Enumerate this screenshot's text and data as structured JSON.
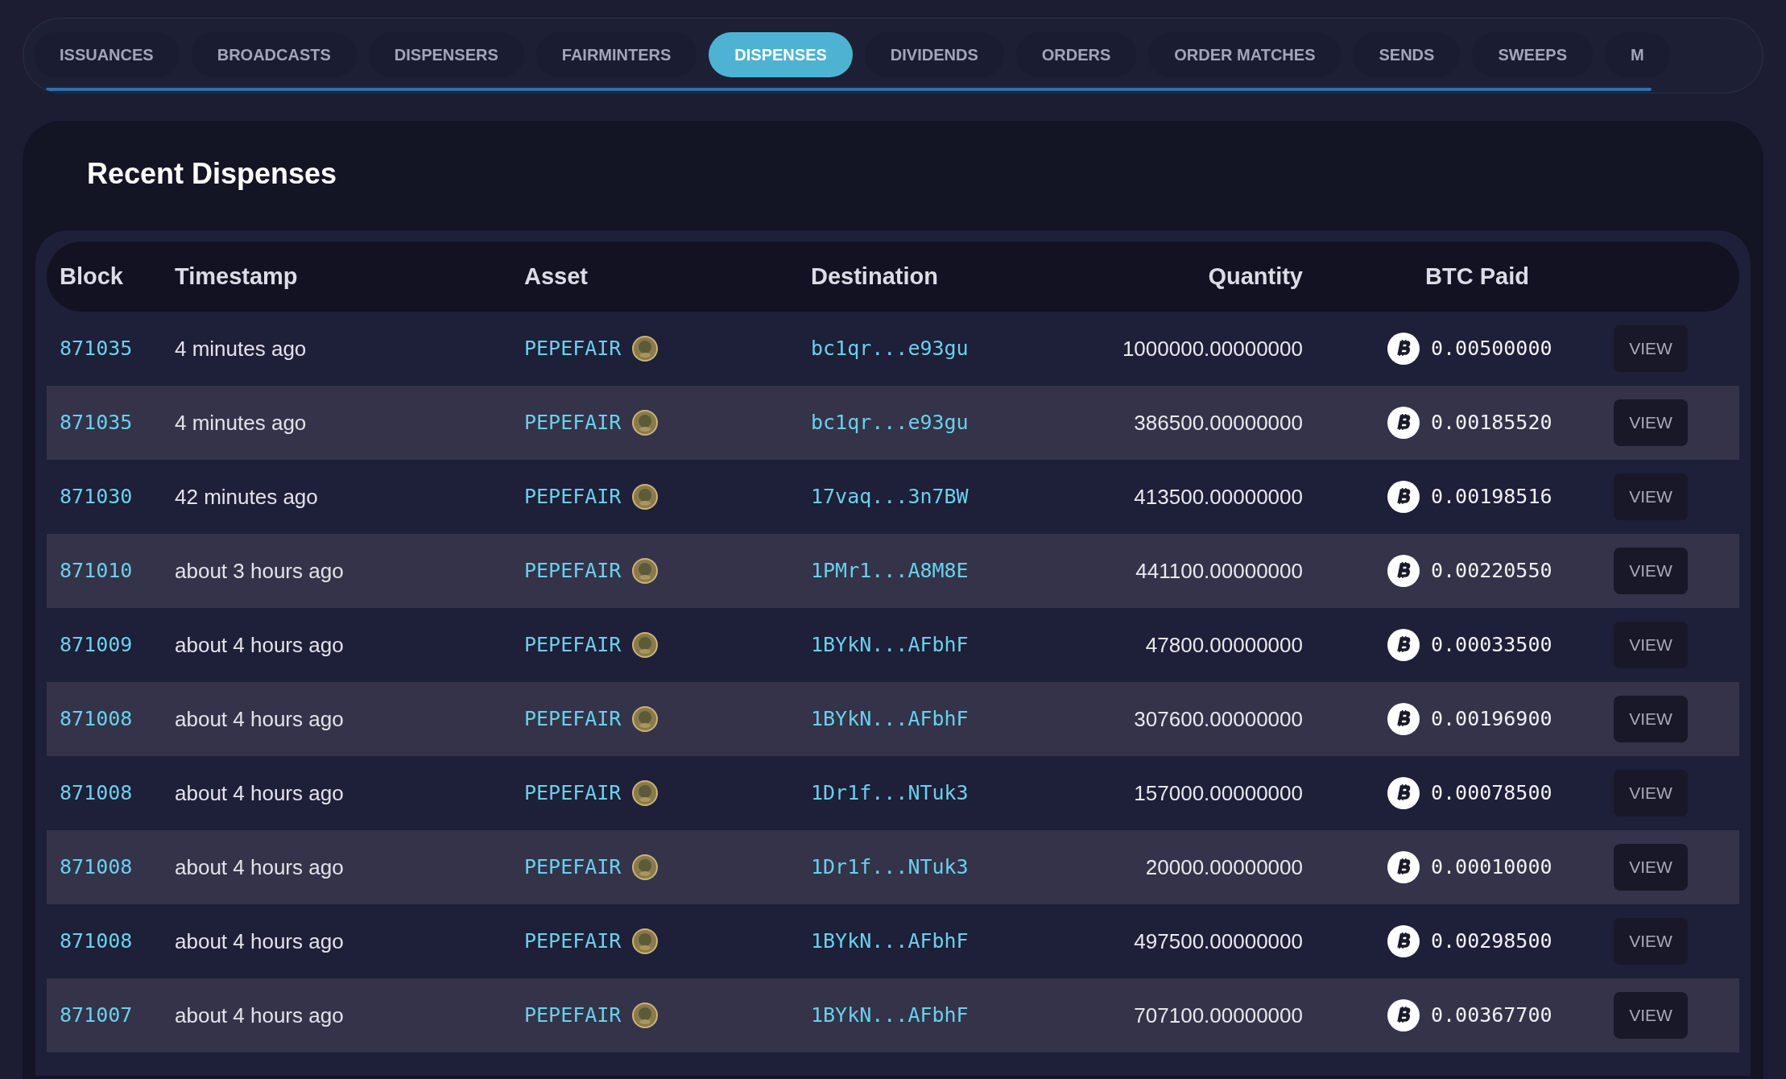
{
  "tabs": [
    {
      "label": "ISSUANCES",
      "selected": false
    },
    {
      "label": "BROADCASTS",
      "selected": false
    },
    {
      "label": "DISPENSERS",
      "selected": false
    },
    {
      "label": "FAIRMINTERS",
      "selected": false
    },
    {
      "label": "DISPENSES",
      "selected": true
    },
    {
      "label": "DIVIDENDS",
      "selected": false
    },
    {
      "label": "ORDERS",
      "selected": false
    },
    {
      "label": "ORDER MATCHES",
      "selected": false
    },
    {
      "label": "SENDS",
      "selected": false
    },
    {
      "label": "SWEEPS",
      "selected": false
    },
    {
      "label": "M",
      "selected": false
    }
  ],
  "title": "Recent Dispenses",
  "table": {
    "columns": [
      "Block",
      "Timestamp",
      "Asset",
      "Destination",
      "Quantity",
      "BTC Paid"
    ],
    "rows": [
      {
        "block": "871035",
        "timestamp": "4 minutes ago",
        "asset": "PEPEFAIR",
        "destination": "bc1qr...e93gu",
        "quantity": "1000000.00000000",
        "btc_paid": "0.00500000",
        "action": "VIEW"
      },
      {
        "block": "871035",
        "timestamp": "4 minutes ago",
        "asset": "PEPEFAIR",
        "destination": "bc1qr...e93gu",
        "quantity": "386500.00000000",
        "btc_paid": "0.00185520",
        "action": "VIEW"
      },
      {
        "block": "871030",
        "timestamp": "42 minutes ago",
        "asset": "PEPEFAIR",
        "destination": "17vaq...3n7BW",
        "quantity": "413500.00000000",
        "btc_paid": "0.00198516",
        "action": "VIEW"
      },
      {
        "block": "871010",
        "timestamp": "about 3 hours ago",
        "asset": "PEPEFAIR",
        "destination": "1PMr1...A8M8E",
        "quantity": "441100.00000000",
        "btc_paid": "0.00220550",
        "action": "VIEW"
      },
      {
        "block": "871009",
        "timestamp": "about 4 hours ago",
        "asset": "PEPEFAIR",
        "destination": "1BYkN...AFbhF",
        "quantity": "47800.00000000",
        "btc_paid": "0.00033500",
        "action": "VIEW"
      },
      {
        "block": "871008",
        "timestamp": "about 4 hours ago",
        "asset": "PEPEFAIR",
        "destination": "1BYkN...AFbhF",
        "quantity": "307600.00000000",
        "btc_paid": "0.00196900",
        "action": "VIEW"
      },
      {
        "block": "871008",
        "timestamp": "about 4 hours ago",
        "asset": "PEPEFAIR",
        "destination": "1Dr1f...NTuk3",
        "quantity": "157000.00000000",
        "btc_paid": "0.00078500",
        "action": "VIEW"
      },
      {
        "block": "871008",
        "timestamp": "about 4 hours ago",
        "asset": "PEPEFAIR",
        "destination": "1Dr1f...NTuk3",
        "quantity": "20000.00000000",
        "btc_paid": "0.00010000",
        "action": "VIEW"
      },
      {
        "block": "871008",
        "timestamp": "about 4 hours ago",
        "asset": "PEPEFAIR",
        "destination": "1BYkN...AFbhF",
        "quantity": "497500.00000000",
        "btc_paid": "0.00298500",
        "action": "VIEW"
      },
      {
        "block": "871007",
        "timestamp": "about 4 hours ago",
        "asset": "PEPEFAIR",
        "destination": "1BYkN...AFbhF",
        "quantity": "707100.00000000",
        "btc_paid": "0.00367700",
        "action": "VIEW"
      }
    ]
  }
}
